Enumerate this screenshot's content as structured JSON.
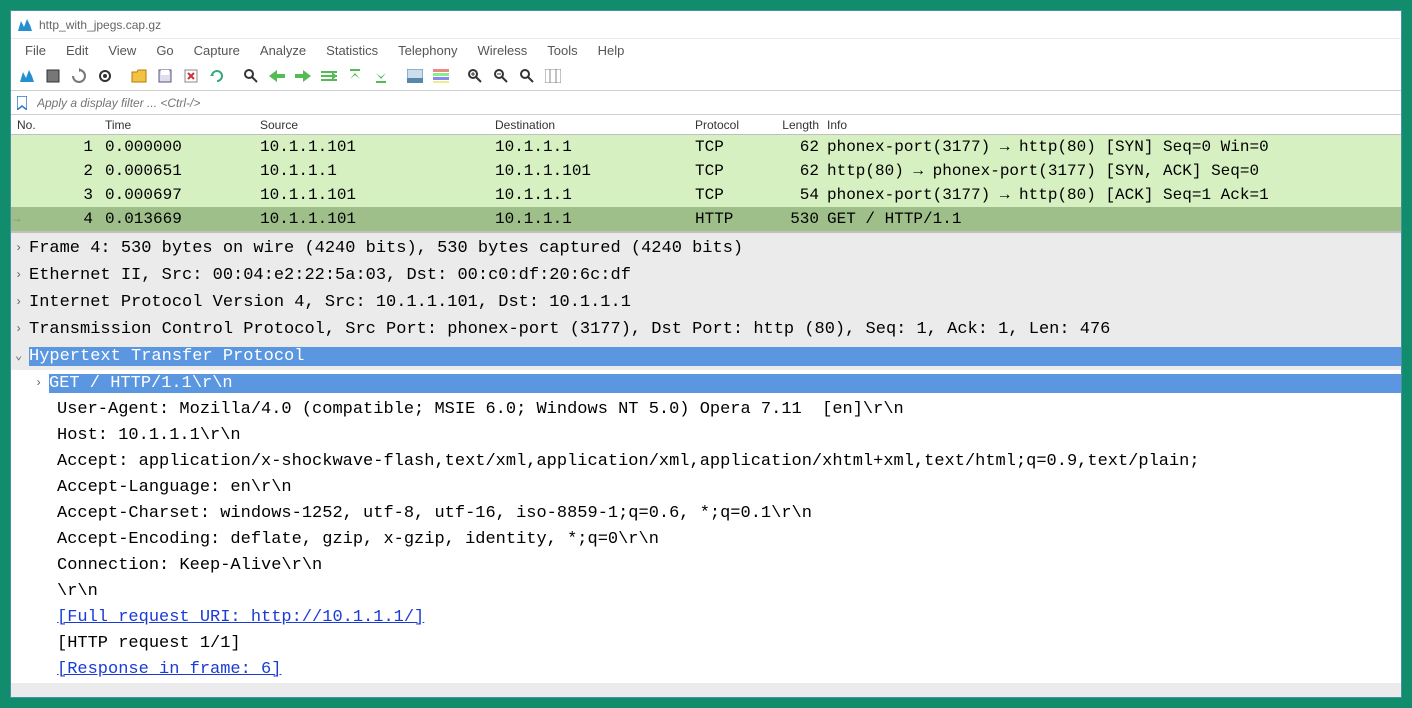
{
  "window": {
    "title": "http_with_jpegs.cap.gz"
  },
  "menu": [
    "File",
    "Edit",
    "View",
    "Go",
    "Capture",
    "Analyze",
    "Statistics",
    "Telephony",
    "Wireless",
    "Tools",
    "Help"
  ],
  "filter": {
    "placeholder": "Apply a display filter ... <Ctrl-/>"
  },
  "columns": {
    "no": "No.",
    "time": "Time",
    "source": "Source",
    "destination": "Destination",
    "protocol": "Protocol",
    "length": "Length",
    "info": "Info"
  },
  "packets": [
    {
      "no": "1",
      "time": "0.000000",
      "src": "10.1.1.101",
      "dst": "10.1.1.1",
      "proto": "TCP",
      "len": "62",
      "info": "phonex-port(3177) → http(80) [SYN] Seq=0 Win=0",
      "cls": "green",
      "marker": ""
    },
    {
      "no": "2",
      "time": "0.000651",
      "src": "10.1.1.1",
      "dst": "10.1.1.101",
      "proto": "TCP",
      "len": "62",
      "info": "http(80) → phonex-port(3177) [SYN, ACK] Seq=0",
      "cls": "green",
      "marker": ""
    },
    {
      "no": "3",
      "time": "0.000697",
      "src": "10.1.1.101",
      "dst": "10.1.1.1",
      "proto": "TCP",
      "len": "54",
      "info": "phonex-port(3177) → http(80) [ACK] Seq=1 Ack=1",
      "cls": "green",
      "marker": ""
    },
    {
      "no": "4",
      "time": "0.013669",
      "src": "10.1.1.101",
      "dst": "10.1.1.1",
      "proto": "HTTP",
      "len": "530",
      "info": "GET / HTTP/1.1",
      "cls": "sel",
      "marker": "→"
    }
  ],
  "details": {
    "frame": "Frame 4: 530 bytes on wire (4240 bits), 530 bytes captured (4240 bits)",
    "eth": "Ethernet II, Src: 00:04:e2:22:5a:03, Dst: 00:c0:df:20:6c:df",
    "ip": "Internet Protocol Version 4, Src: 10.1.1.101, Dst: 10.1.1.1",
    "tcp": "Transmission Control Protocol, Src Port: phonex-port (3177), Dst Port: http (80), Seq: 1, Ack: 1, Len: 476",
    "http_header": "Hypertext Transfer Protocol",
    "get": "GET / HTTP/1.1\\r\\n",
    "ua": "User-Agent: Mozilla/4.0 (compatible; MSIE 6.0; Windows NT 5.0) Opera 7.11  [en]\\r\\n",
    "host": "Host: 10.1.1.1\\r\\n",
    "accept": "Accept: application/x-shockwave-flash,text/xml,application/xml,application/xhtml+xml,text/html;q=0.9,text/plain;",
    "acc_lang": "Accept-Language: en\\r\\n",
    "acc_charset": "Accept-Charset: windows-1252, utf-8, utf-16, iso-8859-1;q=0.6, *;q=0.1\\r\\n",
    "acc_enc": "Accept-Encoding: deflate, gzip, x-gzip, identity, *;q=0\\r\\n",
    "conn": "Connection: Keep-Alive\\r\\n",
    "crlf": "\\r\\n",
    "full_uri": "[Full request URI: http://10.1.1.1/]",
    "req_count": "[HTTP request 1/1]",
    "resp_frame": "[Response in frame: 6]"
  }
}
